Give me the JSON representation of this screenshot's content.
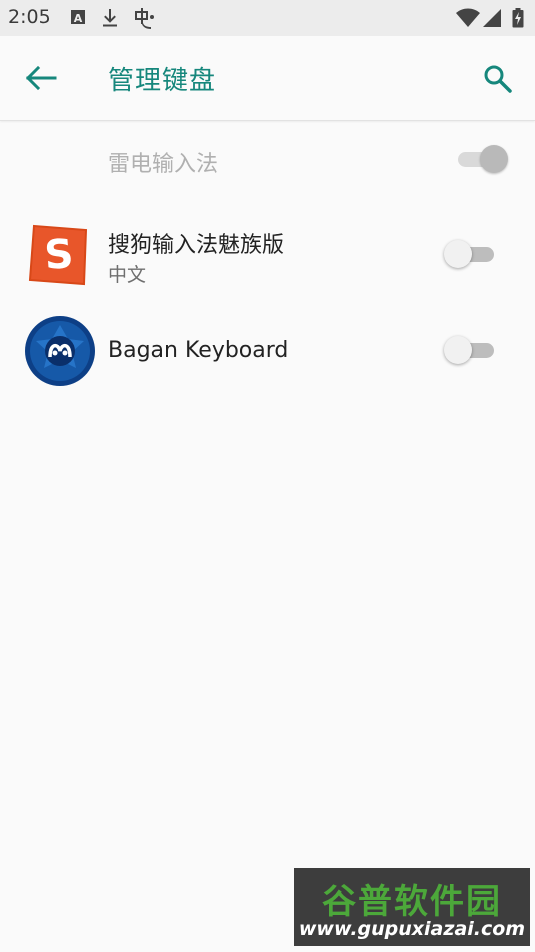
{
  "status_bar": {
    "time": "2:05",
    "icons": [
      "keyboard-a-icon",
      "download-icon",
      "app-notification-icon",
      "wifi-icon",
      "cellular-signal-icon",
      "battery-icon"
    ]
  },
  "appbar": {
    "title": "管理键盘",
    "back_icon": "arrow-back-icon",
    "search_icon": "search-icon",
    "accent_color": "#16877c"
  },
  "keyboards": [
    {
      "name": "雷电输入法",
      "subtitle": "",
      "enabled": true,
      "toggle_disabled": true
    },
    {
      "name": "搜狗输入法魅族版",
      "subtitle": "中文",
      "enabled": false,
      "toggle_disabled": false,
      "icon": "sogou-s-icon",
      "icon_color": "#e8562a"
    },
    {
      "name": "Bagan Keyboard",
      "subtitle": "",
      "enabled": false,
      "toggle_disabled": false,
      "icon": "bagan-keyboard-icon",
      "icon_color": "#1659a8"
    }
  ],
  "watermark": {
    "title": "谷普软件园",
    "url": "www.gupuxiazai.com"
  }
}
